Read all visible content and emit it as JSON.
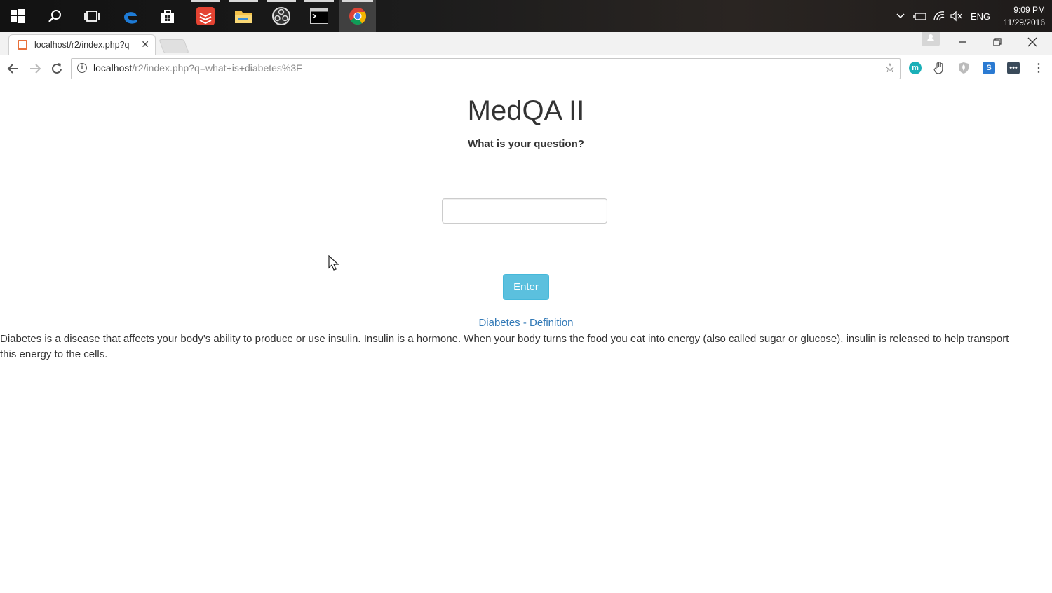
{
  "taskbar": {
    "apps": [
      {
        "name": "start-icon"
      },
      {
        "name": "search-icon"
      },
      {
        "name": "task-view-icon"
      },
      {
        "name": "edge-icon"
      },
      {
        "name": "store-icon"
      },
      {
        "name": "todoist-icon"
      },
      {
        "name": "file-explorer-icon"
      },
      {
        "name": "obs-icon"
      },
      {
        "name": "terminal-icon"
      },
      {
        "name": "chrome-icon"
      }
    ],
    "language": "ENG",
    "time": "9:09 PM",
    "date": "11/29/2016"
  },
  "browser": {
    "tab_title": "localhost/r2/index.php?q",
    "url_host": "localhost",
    "url_path": "/r2/index.php?q=what+is+diabetes%3F"
  },
  "page": {
    "title": "MedQA II",
    "subtitle": "What is your question?",
    "input_value": "",
    "enter_label": "Enter",
    "answer_title": "Diabetes - Definition",
    "answer_text": "Diabetes is a disease that affects your body's ability to produce or use insulin. Insulin is a hormone. When your body turns the food you eat into energy (also called sugar or glucose), insulin is released to help transport this energy to the cells."
  },
  "colors": {
    "button": "#5bc0de",
    "link": "#337ab7",
    "text": "#333333"
  }
}
